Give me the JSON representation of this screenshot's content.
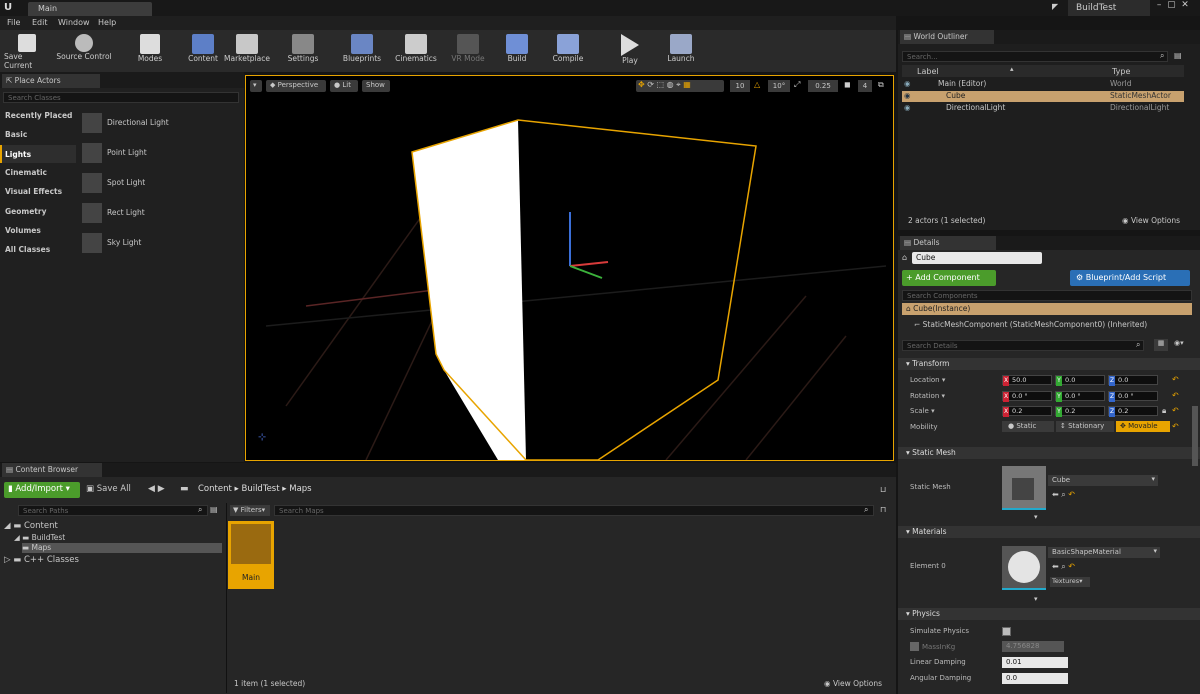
{
  "window": {
    "doc_tab": "Main",
    "project_name": "BuildTest"
  },
  "menu": [
    "File",
    "Edit",
    "Window",
    "Help"
  ],
  "toolbar": [
    {
      "label": "Save Current",
      "icon": "save-icon"
    },
    {
      "label": "Source Control",
      "icon": "source-control-icon"
    },
    {
      "label": "Modes",
      "icon": "modes-icon"
    },
    {
      "label": "Content",
      "icon": "content-icon"
    },
    {
      "label": "Marketplace",
      "icon": "marketplace-icon"
    },
    {
      "label": "Settings",
      "icon": "settings-icon"
    },
    {
      "label": "Blueprints",
      "icon": "blueprints-icon"
    },
    {
      "label": "Cinematics",
      "icon": "cinematics-icon"
    },
    {
      "label": "VR Mode",
      "icon": "vr-mode-icon"
    },
    {
      "label": "Build",
      "icon": "build-icon"
    },
    {
      "label": "Compile",
      "icon": "compile-icon"
    },
    {
      "label": "Play",
      "icon": "play-icon"
    },
    {
      "label": "Launch",
      "icon": "launch-icon"
    }
  ],
  "place_actors": {
    "tab": "Place Actors",
    "search_placeholder": "Search Classes",
    "categories": [
      "Recently Placed",
      "Basic",
      "Lights",
      "Cinematic",
      "Visual Effects",
      "Geometry",
      "Volumes",
      "All Classes"
    ],
    "selected_category": "Lights",
    "items": [
      "Directional Light",
      "Point Light",
      "Spot Light",
      "Rect Light",
      "Sky Light"
    ]
  },
  "viewport": {
    "perspective": "Perspective",
    "lit": "Lit",
    "show": "Show",
    "grid_snap": "10",
    "rot_snap": "10°",
    "scale_snap": "0.25",
    "cam_speed": "4"
  },
  "outliner": {
    "tab": "World Outliner",
    "search_placeholder": "Search...",
    "col_label": "Label",
    "col_type": "Type",
    "rows": [
      {
        "label": "Main (Editor)",
        "type": "World"
      },
      {
        "label": "Cube",
        "type": "StaticMeshActor"
      },
      {
        "label": "DirectionalLight",
        "type": "DirectionalLight"
      }
    ],
    "status": "2 actors (1 selected)",
    "view_options": "View Options"
  },
  "details": {
    "tab": "Details",
    "name": "Cube",
    "add_component": "+ Add Component",
    "blueprint": "Blueprint/Add Script",
    "search_components": "Search Components",
    "instance": "Cube(Instance)",
    "component": "StaticMeshComponent (StaticMeshComponent0) (Inherited)",
    "search_details": "Search Details",
    "transform": "Transform",
    "location_label": "Location",
    "rotation_label": "Rotation",
    "scale_label": "Scale",
    "mobility_label": "Mobility",
    "location": [
      "50.0",
      "0.0",
      "0.0"
    ],
    "rotation": [
      "0.0 °",
      "0.0 °",
      "0.0 °"
    ],
    "scale": [
      "0.2",
      "0.2",
      "0.2"
    ],
    "axis_letters": [
      "X",
      "Y",
      "Z"
    ],
    "mobility": [
      "Static",
      "Stationary",
      "Movable"
    ],
    "static_mesh_section": "Static Mesh",
    "static_mesh_label": "Static Mesh",
    "static_mesh_value": "Cube",
    "materials_section": "Materials",
    "element_label": "Element 0",
    "material_value": "BasicShapeMaterial",
    "textures": "Textures",
    "physics_section": "Physics",
    "simulate_physics": "Simulate Physics",
    "mass_label": "MassInKg",
    "mass_value": "4.756828",
    "linear_damping_label": "Linear Damping",
    "linear_damping": "0.01",
    "angular_damping_label": "Angular Damping",
    "angular_damping": "0.0"
  },
  "content_browser": {
    "tab": "Content Browser",
    "add_import": "Add/Import",
    "save_all": "Save All",
    "path": [
      "Content",
      "BuildTest",
      "Maps"
    ],
    "search_paths": "Search Paths",
    "filters": "Filters",
    "search_maps": "Search Maps",
    "tree": [
      "Content",
      "BuildTest",
      "Maps",
      "C++ Classes"
    ],
    "asset_name": "Main",
    "status": "1 item (1 selected)",
    "view_options": "View Options"
  },
  "colors": {
    "accent": "#e8a400",
    "add_green": "#4b9c2b",
    "blueprint_blue": "#2a6fb6",
    "selection": "#c8a16e"
  }
}
